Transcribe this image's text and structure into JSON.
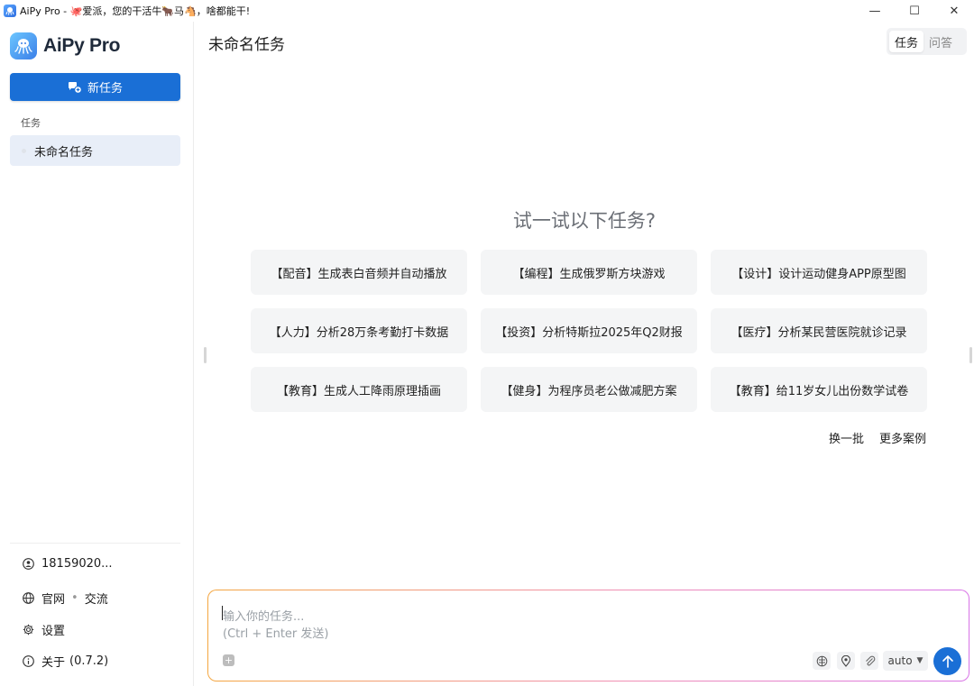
{
  "window": {
    "title": "AiPy Pro - ",
    "title_tagline": "爱派，您的干活牛",
    "title_tagline_mid": "马",
    "title_tagline_end": "，啥都能干!",
    "minimize": "—",
    "maximize": "☐",
    "close": "✕"
  },
  "sidebar": {
    "brand": "AiPy Pro",
    "new_task": "新任务",
    "section_label": "任务",
    "tasks": [
      {
        "label": "未命名任务"
      }
    ],
    "footer": {
      "account": "18159020...",
      "website": "官网",
      "separator": "•",
      "community": "交流",
      "settings": "设置",
      "about": "关于",
      "version": "(0.7.2)"
    }
  },
  "header": {
    "title": "未命名任务",
    "modes": [
      "任务",
      "问答"
    ]
  },
  "suggestions": {
    "title": "试一试以下任务?",
    "items": [
      "【配音】生成表白音频并自动播放",
      "【编程】生成俄罗斯方块游戏",
      "【设计】设计运动健身APP原型图",
      "【人力】分析28万条考勤打卡数据",
      "【投资】分析特斯拉2025年Q2财报",
      "【医疗】分析某民营医院就诊记录",
      "【教育】生成人工降雨原理插画",
      "【健身】为程序员老公做减肥方案",
      "【教育】给11岁女儿出份数学试卷"
    ],
    "refresh": "换一批",
    "more": "更多案例"
  },
  "composer": {
    "placeholder_line1": "输入你的任务...",
    "placeholder_line2": "(Ctrl + Enter 发送)",
    "model": "auto",
    "model_caret": "▼",
    "attach": "+"
  },
  "colors": {
    "accent": "#1a6fd6",
    "active_item_bg": "#e8eef8",
    "chip_bg": "#f4f5f6",
    "composer_border_start": "#f4a640",
    "composer_border_end": "#d873e6"
  },
  "icons": {
    "app": "octopus-icon",
    "new_task": "chat-plus-icon",
    "account": "user-circle-icon",
    "website": "globe-icon",
    "settings": "gear-icon",
    "about": "info-icon",
    "send": "arrow-up-icon"
  }
}
